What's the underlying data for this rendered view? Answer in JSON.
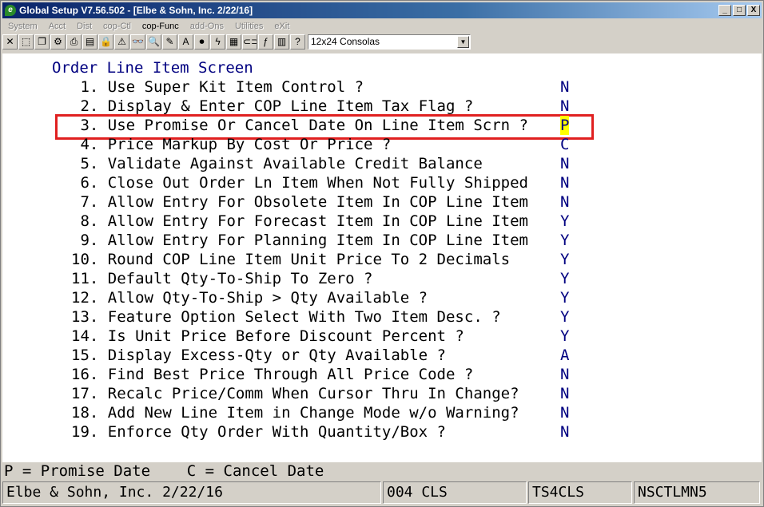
{
  "window": {
    "title": "Global Setup V7.56.502 - [Elbe & Sohn, Inc. 2/22/16]",
    "minimize": "_",
    "restore": "□",
    "close": "X"
  },
  "menu": [
    {
      "label": "System",
      "active": false
    },
    {
      "label": "Acct",
      "active": false
    },
    {
      "label": "Dist",
      "active": false
    },
    {
      "label": "cop-Ctl",
      "active": false
    },
    {
      "label": "cop-Func",
      "active": true
    },
    {
      "label": "add-Ons",
      "active": false
    },
    {
      "label": "Utilities",
      "active": false
    },
    {
      "label": "eXit",
      "active": false
    }
  ],
  "toolbar": {
    "icons": [
      "close-icon",
      "select-icon",
      "copy-icon",
      "settings-icon",
      "print-icon",
      "notes-icon",
      "lock-icon",
      "warning-icon",
      "binoculars-icon",
      "zoom-icon",
      "edit-icon",
      "font-icon",
      "record-icon",
      "lightning-icon",
      "calc-icon",
      "link-icon",
      "function-icon",
      "save-icon",
      "help-pointer-icon"
    ],
    "glyphs": [
      "✕",
      "⬚",
      "❐",
      "⚙",
      "⎙",
      "▤",
      "🔒",
      "⚠",
      "👓",
      "🔍",
      "✎",
      "A",
      "⏺",
      "ϟ",
      "▦",
      "⊂⊃",
      "ƒ",
      "▥",
      "?"
    ],
    "font_select_value": "12x24 Consolas"
  },
  "screen": {
    "heading": "Order Line Item Screen",
    "options": [
      {
        "label": " 1. Use Super Kit Item Control ?",
        "value": "N"
      },
      {
        "label": " 2. Display & Enter COP Line Item Tax Flag ?",
        "value": "N"
      },
      {
        "label": " 3. Use Promise Or Cancel Date On Line Item Scrn ?",
        "value": "P"
      },
      {
        "label": " 4. Price Markup By Cost Or Price ?",
        "value": "C"
      },
      {
        "label": " 5. Validate Against Available Credit Balance",
        "value": "N"
      },
      {
        "label": " 6. Close Out Order Ln Item When Not Fully Shipped",
        "value": "N"
      },
      {
        "label": " 7. Allow Entry For Obsolete Item In COP Line Item",
        "value": "N"
      },
      {
        "label": " 8. Allow Entry For Forecast Item In COP Line Item",
        "value": "Y"
      },
      {
        "label": " 9. Allow Entry For Planning Item In COP Line Item",
        "value": "Y"
      },
      {
        "label": "10. Round COP Line Item Unit Price To 2 Decimals",
        "value": "Y"
      },
      {
        "label": "11. Default Qty-To-Ship To Zero ?",
        "value": "Y"
      },
      {
        "label": "12. Allow Qty-To-Ship > Qty Available ?",
        "value": "Y"
      },
      {
        "label": "13. Feature Option Select With Two Item Desc. ?",
        "value": "Y"
      },
      {
        "label": "14. Is Unit Price Before Discount Percent ?",
        "value": "Y"
      },
      {
        "label": "15. Display Excess-Qty or Qty Available ?",
        "value": "A"
      },
      {
        "label": "16. Find Best Price Through All Price Code ?",
        "value": "N"
      },
      {
        "label": "17. Recalc Price/Comm When Cursor Thru In Change?",
        "value": "N"
      },
      {
        "label": "18. Add New Line Item in Change Mode w/o Warning?",
        "value": "N"
      },
      {
        "label": "19. Enforce Qty Order With Quantity/Box ?",
        "value": "N"
      }
    ],
    "active_index": 2
  },
  "prompt": "P = Promise Date    C = Cancel Date",
  "status": {
    "company": "Elbe & Sohn, Inc. 2/22/16",
    "code": "004 CLS",
    "terminal": "TS4CLS",
    "program": "NSCTLMN5"
  },
  "colors": {
    "accent_box": "#e02020",
    "cursor_bg": "#ffff00",
    "value_text": "#000080"
  }
}
